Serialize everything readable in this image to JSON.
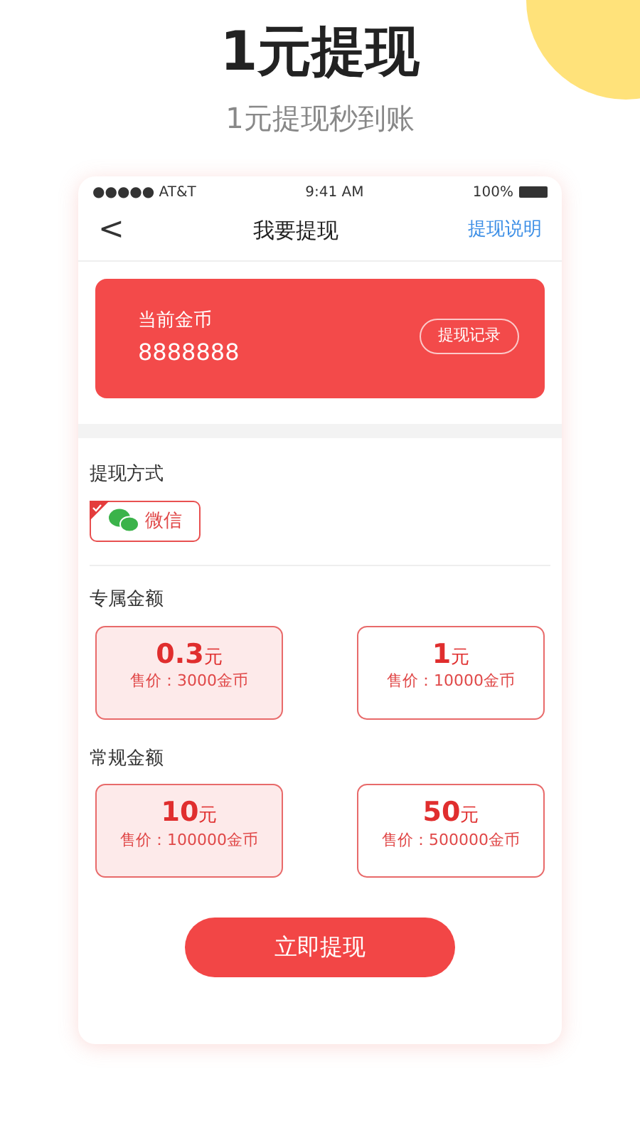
{
  "headline": "1元提现",
  "subheadline": "1元提现秒到账",
  "status_bar": {
    "carrier": "●●●●● AT&T",
    "time": "9:41 AM",
    "battery": "100%"
  },
  "nav": {
    "back": "<",
    "title": "我要提现",
    "action": "提现说明"
  },
  "balance": {
    "label": "当前金币",
    "value": "8888888",
    "button": "提现记录"
  },
  "method": {
    "title": "提现方式",
    "options": [
      {
        "label": "微信",
        "selected": true
      }
    ]
  },
  "sections": [
    {
      "title": "专属金额",
      "options": [
        {
          "amount": "0.3",
          "unit": "元",
          "price": "售价：3000金币",
          "selected": true
        },
        {
          "amount": "1",
          "unit": "元",
          "price": "售价：10000金币",
          "selected": false
        }
      ]
    },
    {
      "title": "常规金额",
      "options": [
        {
          "amount": "10",
          "unit": "元",
          "price": "售价：100000金币",
          "selected": true
        },
        {
          "amount": "50",
          "unit": "元",
          "price": "售价：500000金币",
          "selected": false
        }
      ]
    }
  ],
  "submit": "立即提现"
}
